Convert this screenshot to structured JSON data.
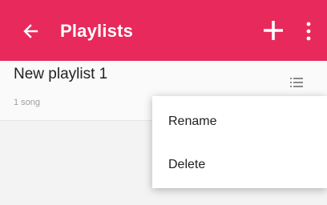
{
  "appbar": {
    "title": "Playlists",
    "back_icon": "arrow-left-icon",
    "add_icon": "plus-icon",
    "more_icon": "more-vertical-icon",
    "color": "#e8295b"
  },
  "playlists": [
    {
      "name": "New playlist 1",
      "song_count": "1 song",
      "handle_icon": "reorder-icon"
    }
  ],
  "context_menu": {
    "items": [
      "Rename",
      "Delete"
    ]
  }
}
